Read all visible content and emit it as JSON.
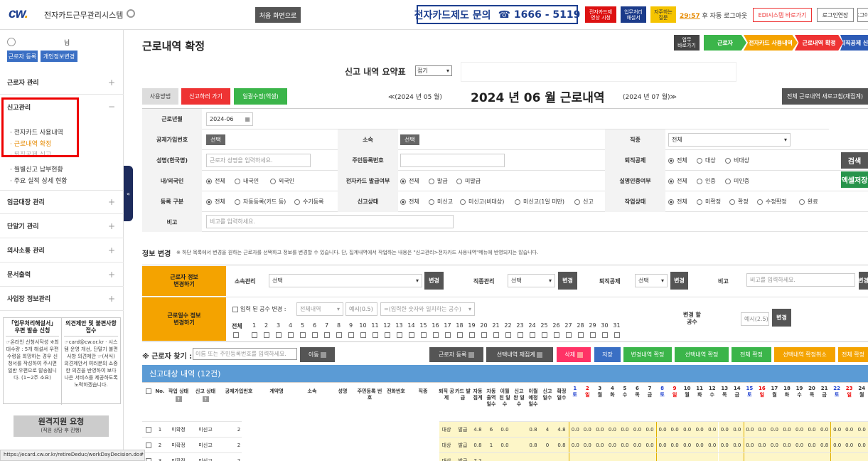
{
  "header": {
    "logo_main": "cw",
    "logo_dot": ".",
    "system_name": "전자카드근무관리시스템",
    "home_label": "처음 화면으로",
    "inquiry_label": "전자카드제도 문의",
    "inquiry_phone": "☎ 1666 - 5119",
    "pill_video": [
      "전자카드제",
      "영상 시청"
    ],
    "pill_manual": [
      "업무처리",
      "해설서"
    ],
    "pill_faq": [
      "자주하는",
      "질문"
    ],
    "timer_value": "29:57",
    "timer_suffix": "후 자동 로그아웃",
    "edi_label": "EDI시스템 바로가기",
    "extend_label": "로그인연장",
    "logout_label": "로그아웃"
  },
  "sidebar": {
    "user_name": "님",
    "register_label": "근로자 등록",
    "personal_label": "개인정보변경",
    "menus": [
      {
        "label": "근로자 관리",
        "toggle": "+"
      },
      {
        "label": "신고관리",
        "toggle": "−"
      },
      {
        "label": "임금대장 관리",
        "toggle": "+"
      },
      {
        "label": "단말기 관리",
        "toggle": "+"
      },
      {
        "label": "의사소통 관리",
        "toggle": "+"
      },
      {
        "label": "문서출력",
        "toggle": "+"
      },
      {
        "label": "사업장 정보관리",
        "toggle": "+"
      }
    ],
    "submenus": [
      "전자카드 사용내역",
      "근로내역 확정",
      "퇴직공제 신고",
      "월별신고 납부현황",
      "주요 실적 상세 현황"
    ],
    "collapse_label": "«",
    "notice_left_title": "「업무처리해설서」 우편 발송 신청",
    "notice_left_body": "☞온라인 신청서작성 ※최대수량 : 5개 해설서 우편 수령을 희망하는 경우 신청서를 작성하여 주시면 일반 우편으로 발송됩니다. (1~2주 소요)",
    "notice_right_title": "의견제안 및 불편사항 접수",
    "notice_right_body": "☞card@cw.or.kr · 시스템 운영 개선, 단말기 불편사항 의견제안 ☞(서식) 의견제안서 여러분의 소중한 의견을 반영하여 보다 나은 서비스를 제공하도록 노력하겠습니다.",
    "remote_label": "원격지원 요청",
    "remote_sub": "(직원 상담 후 진행)"
  },
  "statusbar": "https://ecard.cw.or.kr/retireDeduc/workDayDecision.do#",
  "page": {
    "title": "근로내역 확정",
    "quick_label": [
      "업무",
      "바로가기"
    ],
    "steps": [
      "근로자",
      "전자카드 사용내역",
      "근로내역 확정",
      "퇴직공제 신"
    ],
    "summary_title": "신고 내역 요약표",
    "summary_toggle": "접기",
    "btn_howto": "사용방법",
    "btn_report": "신고하러 가기",
    "btn_bulk": "일괄수정(엑셀)",
    "prev_month": "≪(2024 년 05 월)",
    "current_month": "2024 년 06 월 근로내역",
    "next_month": "(2024 년 07 월)≫",
    "recalc_label": "전체 근로내역 새로고침(재집계)"
  },
  "form": {
    "work_month_label": "근로년월",
    "work_month_value": "2024-06",
    "deduction_no_label": "공제가입번호",
    "select_label": "선택",
    "affiliation_label": "소속",
    "job_label": "직종",
    "job_value": "전체",
    "name_label": "성명(한국명)",
    "name_placeholder": "근로자 성명을 입력하세요.",
    "rrn_label": "주민등록번호",
    "retire_label": "퇴직공제",
    "retire_opts": [
      "전체",
      "대상",
      "비대상"
    ],
    "nat_label": "내/외국인",
    "nat_opts": [
      "전체",
      "내국인",
      "외국인"
    ],
    "card_label": "전자카드 발급여부",
    "card_opts": [
      "전체",
      "발급",
      "미발급"
    ],
    "auth_label": "실명인증여부",
    "auth_opts": [
      "전체",
      "인증",
      "미인증"
    ],
    "regtype_label": "등록 구분",
    "regtype_opts": [
      "전체",
      "자동등록(카드 등)",
      "수기등록"
    ],
    "repstate_label": "신고상태",
    "repstate_opts": [
      "전체",
      "미신고",
      "미신고(비대상)",
      "미신고(1일 미만)",
      "신고"
    ],
    "workstate_label": "작업상태",
    "workstate_opts": [
      "전체",
      "미확정",
      "확정",
      "수정확정",
      "완료"
    ],
    "memo_label": "비고",
    "memo_placeholder": "비고를 입력하세요.",
    "search_label": "검색",
    "excel_label": "엑셀저장"
  },
  "info": {
    "title": "정보 변경",
    "note": "※ 하단 목록에서 변경을 원하는 근로자를 선택하고 정보를 변경할 수 있습니다. 단, 집계내역에서 작업하는 내용은 \"신고관리>전자카드 사용내역\"메뉴에 반영되지는 않습니다.",
    "box1": [
      "근로자 정보",
      "변경하기"
    ],
    "box2": [
      "근로일수 정보",
      "변경하기"
    ],
    "org_label": "소속관리",
    "org_value": "선택",
    "change_label": "변경",
    "jobmgr_label": "직종관리",
    "jobmgr_value": "선택",
    "retire_label": "퇴직공제",
    "retire_value": "선택",
    "memo_label": "비고",
    "memo_placeholder": "비고를 입력하세요.",
    "hours_check_label": "입력 된 공수 변경 :",
    "hours_sel1": "전체내역",
    "hours_ex": "예시(0.5)",
    "hours_sel2": "=(입력한 숫자와 일치하는 공수)",
    "all_label": "전체",
    "days": [
      "1",
      "2",
      "3",
      "4",
      "5",
      "6",
      "7",
      "8",
      "9",
      "10",
      "11",
      "12",
      "13",
      "14",
      "15",
      "16",
      "17",
      "18",
      "19",
      "20",
      "21",
      "22",
      "23",
      "24",
      "25",
      "26",
      "27",
      "28",
      "29",
      "30",
      "31"
    ],
    "target_label": [
      "변경 할",
      "공수"
    ],
    "target_ex": "예시(2.5)"
  },
  "actions": {
    "worker_search_label": "※ 근로자 찾기 :",
    "worker_search_placeholder": "이름 또는 주민등록번호를 입력하세요.",
    "move_label": "이동",
    "buttons": [
      "근로자 등록",
      "선택내역 재집계",
      "삭제",
      "저장",
      "변경내역 확정",
      "선택내역 확정",
      "전체 확정",
      "선택내역 확정취소",
      "전체 확정"
    ]
  },
  "table": {
    "title": "신고대상 내역 (12건)",
    "headers": [
      "No.",
      "작업 상태",
      "신고 상태",
      "공제가입번호",
      "계약명",
      "소속",
      "성명",
      "주민등록 번호",
      "전화번호",
      "직종",
      "퇴직 공제",
      "카드 발급",
      "자동 집계",
      "자동 출역 일수",
      "이월 된 일수",
      "신고 완 일수",
      "이월 예정 일수",
      "신고 일수",
      "확정 일수"
    ],
    "days": [
      {
        "d": "1",
        "w": "토"
      },
      {
        "d": "2",
        "w": "일"
      },
      {
        "d": "3",
        "w": "월"
      },
      {
        "d": "4",
        "w": "화"
      },
      {
        "d": "5",
        "w": "수"
      },
      {
        "d": "6",
        "w": "목"
      },
      {
        "d": "7",
        "w": "금"
      },
      {
        "d": "8",
        "w": "토"
      },
      {
        "d": "9",
        "w": "일"
      },
      {
        "d": "10",
        "w": "월"
      },
      {
        "d": "11",
        "w": "화"
      },
      {
        "d": "12",
        "w": "수"
      },
      {
        "d": "13",
        "w": "목"
      },
      {
        "d": "14",
        "w": "금"
      },
      {
        "d": "15",
        "w": "토"
      },
      {
        "d": "16",
        "w": "일"
      },
      {
        "d": "17",
        "w": "월"
      },
      {
        "d": "18",
        "w": "화"
      },
      {
        "d": "19",
        "w": "수"
      },
      {
        "d": "20",
        "w": "목"
      },
      {
        "d": "21",
        "w": "금"
      },
      {
        "d": "22",
        "w": "토"
      },
      {
        "d": "23",
        "w": "일"
      },
      {
        "d": "24",
        "w": "월"
      }
    ],
    "rows": [
      {
        "no": "1",
        "work": "미확정",
        "report": "미신고",
        "deduct": "2",
        "retire": "대상",
        "card": "발급",
        "auto": "4.8",
        "autodays": "6",
        "carry": "0.0",
        "done": "",
        "carryplan": "0.8",
        "report_days": "4",
        "confirm": "4.8",
        "vals": [
          "0.0",
          "0.0",
          "0.0",
          "0.0",
          "0.0",
          "0.0",
          "0.0",
          "0.0",
          "0.0",
          "0.0",
          "0.0",
          "0.0",
          "0.0",
          "0.0",
          "0.0",
          "0.0",
          "0.0",
          "0.0",
          "0.0",
          "0.0",
          "0.0",
          "0.0",
          "0.0",
          "0.0"
        ]
      },
      {
        "no": "2",
        "work": "미확정",
        "report": "미신고",
        "deduct": "2",
        "retire": "대상",
        "card": "발급",
        "auto": "0.8",
        "autodays": "1",
        "carry": "0.0",
        "done": "",
        "carryplan": "0.8",
        "report_days": "0",
        "confirm": "0.8",
        "vals": [
          "0.0",
          "0.0",
          "0.0",
          "0.0",
          "0.0",
          "0.0",
          "0.0",
          "0.0",
          "0.0",
          "0.0",
          "0.0",
          "0.0",
          "0.0",
          "0.0",
          "0.0",
          "0.0",
          "0.0",
          "0.0",
          "0.0",
          "0.0",
          "0.8",
          "0.0",
          "0.0",
          "0.0"
        ]
      },
      {
        "no": "3",
        "work": "미확정",
        "report": "미신고",
        "deduct": "2",
        "retire": "대상",
        "card": "발급",
        "auto": "7.2",
        "autodays": "",
        "carry": "",
        "done": "",
        "carryplan": "",
        "report_days": "",
        "confirm": "",
        "vals": [
          "",
          "",
          "",
          "",
          "",
          "",
          "",
          "",
          "",
          "",
          "",
          "",
          "",
          "",
          "",
          "",
          "",
          "",
          "",
          "",
          "",
          "",
          "",
          ""
        ]
      }
    ]
  }
}
